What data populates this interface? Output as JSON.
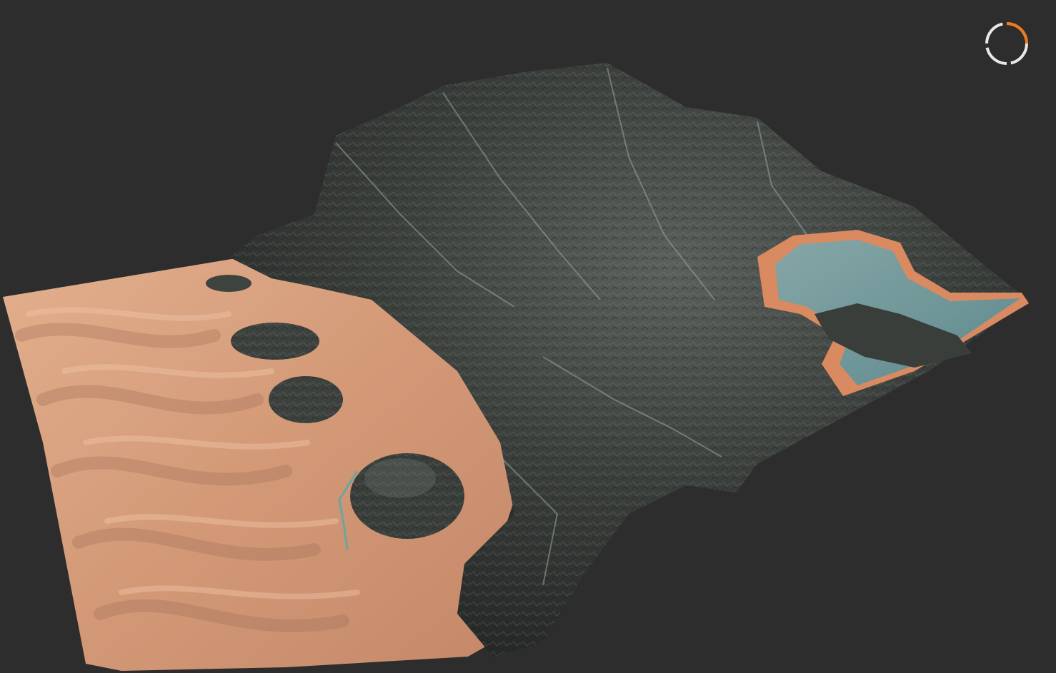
{
  "viewport": {
    "background_color": "#2d2d2d",
    "scene": "3d-terrain-render",
    "terrain_regions": [
      "sand-dunes",
      "rocky-mountain",
      "lake"
    ]
  },
  "colors": {
    "sand": "#d9a07c",
    "sand_shadow": "#9a6a52",
    "rock": "#3a3d3a",
    "rock_highlight": "#7d8680",
    "water": "#6f9496",
    "water_shore": "#d98a60"
  },
  "progress_indicator": {
    "icon": "loading-ring-icon",
    "progress": 0.25,
    "track_color": "#e8e8e8",
    "accent_color": "#f07a18"
  }
}
